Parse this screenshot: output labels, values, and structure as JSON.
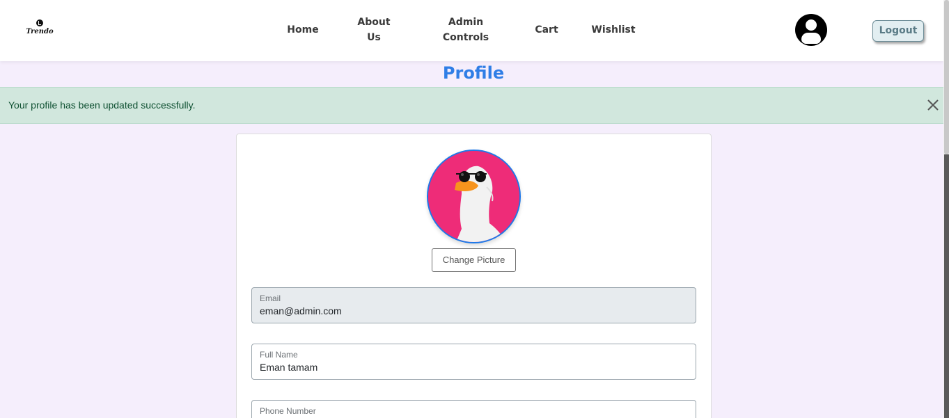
{
  "navbar": {
    "logo_text": "Trendo",
    "links": {
      "home": "Home",
      "about_line1": "About",
      "about_line2": "Us",
      "admin_line1": "Admin",
      "admin_line2": "Controls",
      "cart": "Cart",
      "wishlist": "Wishlist"
    },
    "logout_label": "Logout"
  },
  "page": {
    "title": "Profile"
  },
  "alert": {
    "message": "Your profile has been updated successfully.",
    "close_icon": "close-icon"
  },
  "profile": {
    "picture_icon": "goose-with-sunglasses-avatar",
    "change_picture_label": "Change Picture",
    "fields": {
      "email_label": "Email",
      "email_value": "eman@admin.com",
      "fullname_label": "Full Name",
      "fullname_value": "Eman tamam",
      "phone_label": "Phone Number"
    }
  },
  "colors": {
    "accent": "#2f7ee6",
    "page_background": "#f5eefc",
    "alert_background": "#d1e7dd",
    "alert_text": "#0f5132",
    "avatar_background": "#ee2c78"
  }
}
